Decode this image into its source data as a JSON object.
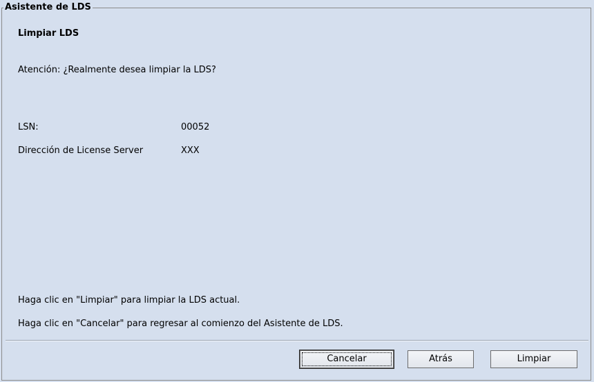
{
  "frame": {
    "title": "Asistente de LDS"
  },
  "wizard": {
    "title": "Limpiar LDS",
    "warning": "Atención: ¿Realmente desea limpiar la LDS?",
    "fields": [
      {
        "label": "LSN:",
        "value": "00052"
      },
      {
        "label": "Dirección de License Server",
        "value": "XXX"
      }
    ],
    "instructions": [
      "Haga clic en \"Limpiar\" para limpiar la LDS actual.",
      "Haga clic en \"Cancelar\" para regresar al comienzo del Asistente de LDS."
    ]
  },
  "buttons": {
    "cancel_label": "Cancelar",
    "back_label": "Atrás",
    "clean_label": "Limpiar"
  }
}
